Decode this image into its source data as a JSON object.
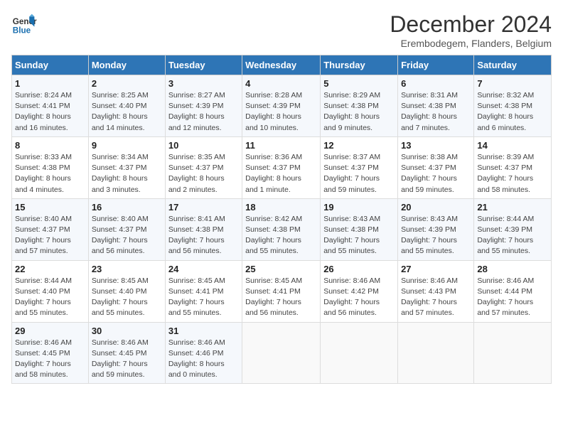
{
  "logo": {
    "line1": "General",
    "line2": "Blue"
  },
  "title": "December 2024",
  "subtitle": "Erembodegem, Flanders, Belgium",
  "days_header": [
    "Sunday",
    "Monday",
    "Tuesday",
    "Wednesday",
    "Thursday",
    "Friday",
    "Saturday"
  ],
  "weeks": [
    [
      {
        "day": "1",
        "info": "Sunrise: 8:24 AM\nSunset: 4:41 PM\nDaylight: 8 hours\nand 16 minutes."
      },
      {
        "day": "2",
        "info": "Sunrise: 8:25 AM\nSunset: 4:40 PM\nDaylight: 8 hours\nand 14 minutes."
      },
      {
        "day": "3",
        "info": "Sunrise: 8:27 AM\nSunset: 4:39 PM\nDaylight: 8 hours\nand 12 minutes."
      },
      {
        "day": "4",
        "info": "Sunrise: 8:28 AM\nSunset: 4:39 PM\nDaylight: 8 hours\nand 10 minutes."
      },
      {
        "day": "5",
        "info": "Sunrise: 8:29 AM\nSunset: 4:38 PM\nDaylight: 8 hours\nand 9 minutes."
      },
      {
        "day": "6",
        "info": "Sunrise: 8:31 AM\nSunset: 4:38 PM\nDaylight: 8 hours\nand 7 minutes."
      },
      {
        "day": "7",
        "info": "Sunrise: 8:32 AM\nSunset: 4:38 PM\nDaylight: 8 hours\nand 6 minutes."
      }
    ],
    [
      {
        "day": "8",
        "info": "Sunrise: 8:33 AM\nSunset: 4:38 PM\nDaylight: 8 hours\nand 4 minutes."
      },
      {
        "day": "9",
        "info": "Sunrise: 8:34 AM\nSunset: 4:37 PM\nDaylight: 8 hours\nand 3 minutes."
      },
      {
        "day": "10",
        "info": "Sunrise: 8:35 AM\nSunset: 4:37 PM\nDaylight: 8 hours\nand 2 minutes."
      },
      {
        "day": "11",
        "info": "Sunrise: 8:36 AM\nSunset: 4:37 PM\nDaylight: 8 hours\nand 1 minute."
      },
      {
        "day": "12",
        "info": "Sunrise: 8:37 AM\nSunset: 4:37 PM\nDaylight: 7 hours\nand 59 minutes."
      },
      {
        "day": "13",
        "info": "Sunrise: 8:38 AM\nSunset: 4:37 PM\nDaylight: 7 hours\nand 59 minutes."
      },
      {
        "day": "14",
        "info": "Sunrise: 8:39 AM\nSunset: 4:37 PM\nDaylight: 7 hours\nand 58 minutes."
      }
    ],
    [
      {
        "day": "15",
        "info": "Sunrise: 8:40 AM\nSunset: 4:37 PM\nDaylight: 7 hours\nand 57 minutes."
      },
      {
        "day": "16",
        "info": "Sunrise: 8:40 AM\nSunset: 4:37 PM\nDaylight: 7 hours\nand 56 minutes."
      },
      {
        "day": "17",
        "info": "Sunrise: 8:41 AM\nSunset: 4:38 PM\nDaylight: 7 hours\nand 56 minutes."
      },
      {
        "day": "18",
        "info": "Sunrise: 8:42 AM\nSunset: 4:38 PM\nDaylight: 7 hours\nand 55 minutes."
      },
      {
        "day": "19",
        "info": "Sunrise: 8:43 AM\nSunset: 4:38 PM\nDaylight: 7 hours\nand 55 minutes."
      },
      {
        "day": "20",
        "info": "Sunrise: 8:43 AM\nSunset: 4:39 PM\nDaylight: 7 hours\nand 55 minutes."
      },
      {
        "day": "21",
        "info": "Sunrise: 8:44 AM\nSunset: 4:39 PM\nDaylight: 7 hours\nand 55 minutes."
      }
    ],
    [
      {
        "day": "22",
        "info": "Sunrise: 8:44 AM\nSunset: 4:40 PM\nDaylight: 7 hours\nand 55 minutes."
      },
      {
        "day": "23",
        "info": "Sunrise: 8:45 AM\nSunset: 4:40 PM\nDaylight: 7 hours\nand 55 minutes."
      },
      {
        "day": "24",
        "info": "Sunrise: 8:45 AM\nSunset: 4:41 PM\nDaylight: 7 hours\nand 55 minutes."
      },
      {
        "day": "25",
        "info": "Sunrise: 8:45 AM\nSunset: 4:41 PM\nDaylight: 7 hours\nand 56 minutes."
      },
      {
        "day": "26",
        "info": "Sunrise: 8:46 AM\nSunset: 4:42 PM\nDaylight: 7 hours\nand 56 minutes."
      },
      {
        "day": "27",
        "info": "Sunrise: 8:46 AM\nSunset: 4:43 PM\nDaylight: 7 hours\nand 57 minutes."
      },
      {
        "day": "28",
        "info": "Sunrise: 8:46 AM\nSunset: 4:44 PM\nDaylight: 7 hours\nand 57 minutes."
      }
    ],
    [
      {
        "day": "29",
        "info": "Sunrise: 8:46 AM\nSunset: 4:45 PM\nDaylight: 7 hours\nand 58 minutes."
      },
      {
        "day": "30",
        "info": "Sunrise: 8:46 AM\nSunset: 4:45 PM\nDaylight: 7 hours\nand 59 minutes."
      },
      {
        "day": "31",
        "info": "Sunrise: 8:46 AM\nSunset: 4:46 PM\nDaylight: 8 hours\nand 0 minutes."
      },
      {
        "day": "",
        "info": ""
      },
      {
        "day": "",
        "info": ""
      },
      {
        "day": "",
        "info": ""
      },
      {
        "day": "",
        "info": ""
      }
    ]
  ]
}
